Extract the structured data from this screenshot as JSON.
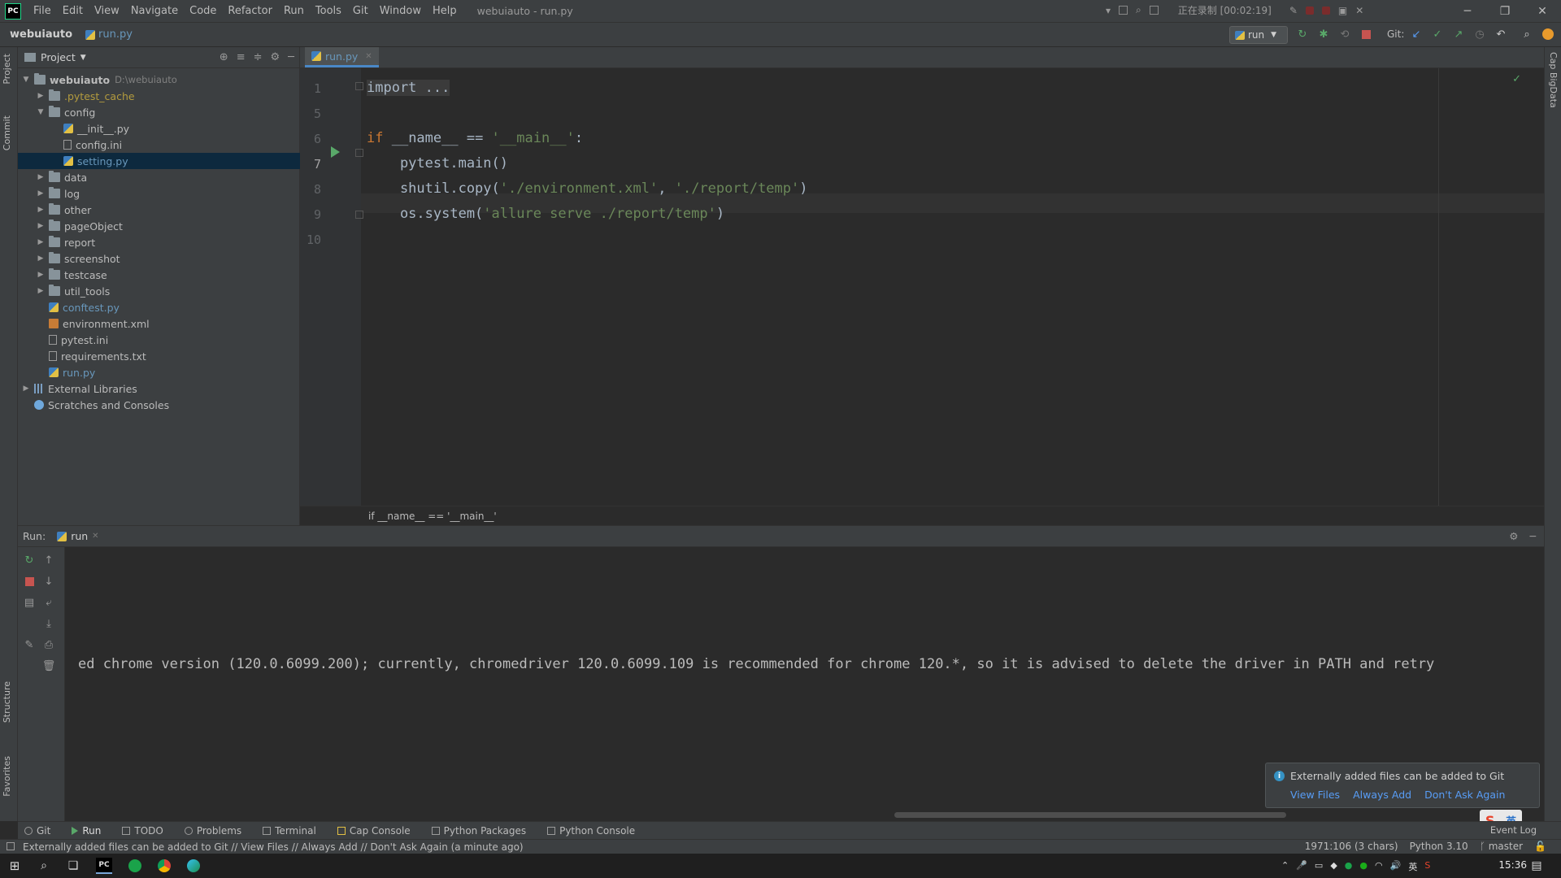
{
  "menubar": {
    "logo": "PC",
    "items": [
      "File",
      "Edit",
      "View",
      "Navigate",
      "Code",
      "Refactor",
      "Run",
      "Tools",
      "Git",
      "Window",
      "Help"
    ],
    "window_title": "webuiauto - run.py",
    "recording": "正在录制 [00:02:19]"
  },
  "navbar": {
    "project": "webuiauto",
    "file": "run.py",
    "run_config": "run",
    "git_label": "Git:"
  },
  "project_panel": {
    "title": "Project",
    "tree": [
      {
        "label": "webuiauto",
        "note": "D:\\webuiauto",
        "depth": 0,
        "arrow": "open",
        "icon": "folder-icon",
        "style": "bold"
      },
      {
        "label": ".pytest_cache",
        "depth": 1,
        "arrow": "closed",
        "icon": "folder-icon",
        "style": "yellow"
      },
      {
        "label": "config",
        "depth": 1,
        "arrow": "open",
        "icon": "folder-icon",
        "style": ""
      },
      {
        "label": "__init__.py",
        "depth": 2,
        "arrow": "",
        "icon": "python-file-icon",
        "style": ""
      },
      {
        "label": "config.ini",
        "depth": 2,
        "arrow": "",
        "icon": "text-file-icon",
        "style": ""
      },
      {
        "label": "setting.py",
        "depth": 2,
        "arrow": "",
        "icon": "python-file-icon",
        "style": "blue",
        "selected": true
      },
      {
        "label": "data",
        "depth": 1,
        "arrow": "closed",
        "icon": "folder-icon",
        "style": ""
      },
      {
        "label": "log",
        "depth": 1,
        "arrow": "closed",
        "icon": "folder-icon",
        "style": ""
      },
      {
        "label": "other",
        "depth": 1,
        "arrow": "closed",
        "icon": "folder-icon",
        "style": ""
      },
      {
        "label": "pageObject",
        "depth": 1,
        "arrow": "closed",
        "icon": "folder-icon",
        "style": ""
      },
      {
        "label": "report",
        "depth": 1,
        "arrow": "closed",
        "icon": "folder-icon",
        "style": ""
      },
      {
        "label": "screenshot",
        "depth": 1,
        "arrow": "closed",
        "icon": "folder-icon",
        "style": ""
      },
      {
        "label": "testcase",
        "depth": 1,
        "arrow": "closed",
        "icon": "folder-icon",
        "style": ""
      },
      {
        "label": "util_tools",
        "depth": 1,
        "arrow": "closed",
        "icon": "folder-icon",
        "style": ""
      },
      {
        "label": "conftest.py",
        "depth": 1,
        "arrow": "",
        "icon": "python-file-icon",
        "style": "blue"
      },
      {
        "label": "environment.xml",
        "depth": 1,
        "arrow": "",
        "icon": "xml-file-icon",
        "style": ""
      },
      {
        "label": "pytest.ini",
        "depth": 1,
        "arrow": "",
        "icon": "text-file-icon",
        "style": ""
      },
      {
        "label": "requirements.txt",
        "depth": 1,
        "arrow": "",
        "icon": "text-file-icon",
        "style": ""
      },
      {
        "label": "run.py",
        "depth": 1,
        "arrow": "",
        "icon": "python-file-icon",
        "style": "blue"
      },
      {
        "label": "External Libraries",
        "depth": 0,
        "arrow": "closed",
        "icon": "library-icon",
        "style": ""
      },
      {
        "label": "Scratches and Consoles",
        "depth": 0,
        "arrow": "",
        "icon": "scratches-icon",
        "style": ""
      }
    ]
  },
  "editor": {
    "tab": "run.py",
    "lines": [
      {
        "no": "1",
        "html": "<span class='fold'>import ...</span>"
      },
      {
        "no": "5",
        "html": ""
      },
      {
        "no": "6",
        "html": "<span class='kw'>if</span> __name__ == <span class='str'>'__main__'</span>:"
      },
      {
        "no": "7",
        "html": "    pytest.main()"
      },
      {
        "no": "8",
        "html": "    shutil.copy(<span class='str'>'./environment.xml'</span>, <span class='str'>'./report/temp'</span>)"
      },
      {
        "no": "9",
        "html": "    os.system(<span class='str'>'allure serve ./report/temp'</span>)"
      },
      {
        "no": "10",
        "html": ""
      }
    ],
    "current_line": "7",
    "breadcrumb": "if __name__ == '__main__'"
  },
  "run_panel": {
    "label": "Run:",
    "tab": "run",
    "output": "ed chrome version (120.0.6099.200); currently, chromedriver 120.0.6099.109 is recommended for chrome 120.*, so it is advised to delete the driver in PATH and retry"
  },
  "notification": {
    "message": "Externally added files can be added to Git",
    "links": [
      "View Files",
      "Always Add",
      "Don't Ask Again"
    ]
  },
  "tool_tabs": [
    "Git",
    "Run",
    "TODO",
    "Problems",
    "Terminal",
    "Cap Console",
    "Python Packages",
    "Python Console"
  ],
  "left_tabs": [
    "Project",
    "Commit",
    "Structure",
    "Favorites"
  ],
  "right_tabs": [
    "Cap BigData"
  ],
  "statusbar": {
    "message": "Externally added files can be added to Git // View Files // Always Add // Don't Ask Again (a minute ago)",
    "position": "1971:106 (3 chars)",
    "interpreter": "Python 3.10",
    "branch": "master",
    "event_log": "Event Log"
  },
  "ime": {
    "logo": "S",
    "lang": "英"
  },
  "taskbar": {
    "clock": "15:36",
    "ime_lang": "英"
  },
  "colors": {
    "background": "#2b2b2b",
    "panel": "#3c3f41",
    "keyword": "#cc7832",
    "string": "#6a8759",
    "link": "#589df6",
    "selection": "#0d293e"
  }
}
